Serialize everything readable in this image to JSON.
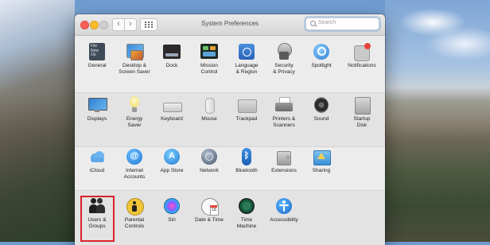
{
  "window": {
    "title": "System Preferences",
    "search_placeholder": "Search",
    "nav_back": "‹",
    "nav_forward": "›"
  },
  "rows": [
    {
      "panes": [
        {
          "label": "General",
          "icon": "general-icon"
        },
        {
          "label": "Desktop &\nScreen Saver",
          "icon": "desktop-icon"
        },
        {
          "label": "Dock",
          "icon": "dock-icon"
        },
        {
          "label": "Mission\nControl",
          "icon": "mission-control-icon"
        },
        {
          "label": "Language\n& Region",
          "icon": "language-icon"
        },
        {
          "label": "Security\n& Privacy",
          "icon": "security-icon"
        },
        {
          "label": "Spotlight",
          "icon": "spotlight-icon"
        },
        {
          "label": "Notifications",
          "icon": "notifications-icon"
        }
      ]
    },
    {
      "panes": [
        {
          "label": "Displays",
          "icon": "displays-icon"
        },
        {
          "label": "Energy\nSaver",
          "icon": "energy-saver-icon"
        },
        {
          "label": "Keyboard",
          "icon": "keyboard-icon"
        },
        {
          "label": "Mouse",
          "icon": "mouse-icon"
        },
        {
          "label": "Trackpad",
          "icon": "trackpad-icon"
        },
        {
          "label": "Printers &\nScanners",
          "icon": "printer-icon"
        },
        {
          "label": "Sound",
          "icon": "sound-icon"
        },
        {
          "label": "Startup\nDisk",
          "icon": "startup-disk-icon"
        }
      ]
    },
    {
      "panes": [
        {
          "label": "iCloud",
          "icon": "icloud-icon"
        },
        {
          "label": "Internet\nAccounts",
          "icon": "internet-accounts-icon"
        },
        {
          "label": "App Store",
          "icon": "app-store-icon"
        },
        {
          "label": "Network",
          "icon": "network-icon"
        },
        {
          "label": "Bluetooth",
          "icon": "bluetooth-icon"
        },
        {
          "label": "Extensions",
          "icon": "extensions-icon"
        },
        {
          "label": "Sharing",
          "icon": "sharing-icon"
        }
      ]
    },
    {
      "panes": [
        {
          "label": "Users &\nGroups",
          "icon": "users-groups-icon"
        },
        {
          "label": "Parental\nControls",
          "icon": "parental-controls-icon"
        },
        {
          "label": "Siri",
          "icon": "siri-icon"
        },
        {
          "label": "Date & Time",
          "icon": "date-time-icon"
        },
        {
          "label": "Time\nMachine",
          "icon": "time-machine-icon"
        },
        {
          "label": "Accessibility",
          "icon": "accessibility-icon"
        }
      ]
    }
  ],
  "general_icon_text": "File\nNew\nOp",
  "calendar_icon_text": "18",
  "colors": {
    "highlight": "#d9232b",
    "search_focus": "#78aae6"
  }
}
